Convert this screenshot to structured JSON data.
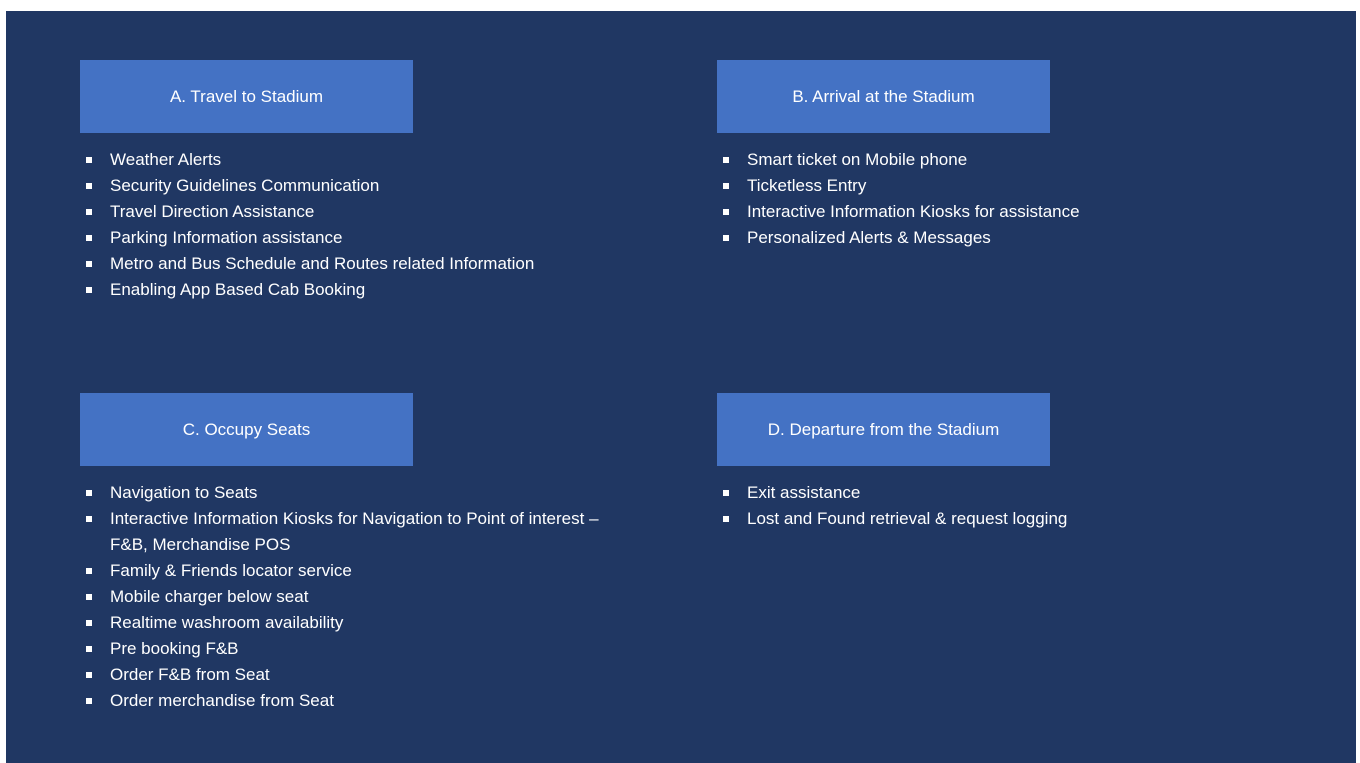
{
  "sections": [
    {
      "title": "A. Travel to Stadium",
      "items": [
        "Weather Alerts",
        "Security Guidelines Communication",
        "Travel Direction Assistance",
        "Parking Information assistance",
        "Metro and Bus Schedule and Routes related Information",
        "Enabling App Based Cab Booking"
      ]
    },
    {
      "title": "B. Arrival at the Stadium",
      "items": [
        "Smart ticket on Mobile phone",
        "Ticketless Entry",
        "Interactive Information Kiosks for assistance",
        "Personalized Alerts & Messages"
      ]
    },
    {
      "title": "C. Occupy Seats",
      "items": [
        "Navigation to Seats",
        "Interactive Information Kiosks for Navigation to Point of interest – F&B, Merchandise POS",
        "Family & Friends locator service",
        "Mobile charger below seat",
        "Realtime washroom availability",
        "Pre booking F&B",
        "Order F&B from Seat",
        "Order merchandise from Seat"
      ]
    },
    {
      "title": "D. Departure from the Stadium",
      "items": [
        "Exit assistance",
        "Lost and Found retrieval & request logging"
      ]
    }
  ]
}
